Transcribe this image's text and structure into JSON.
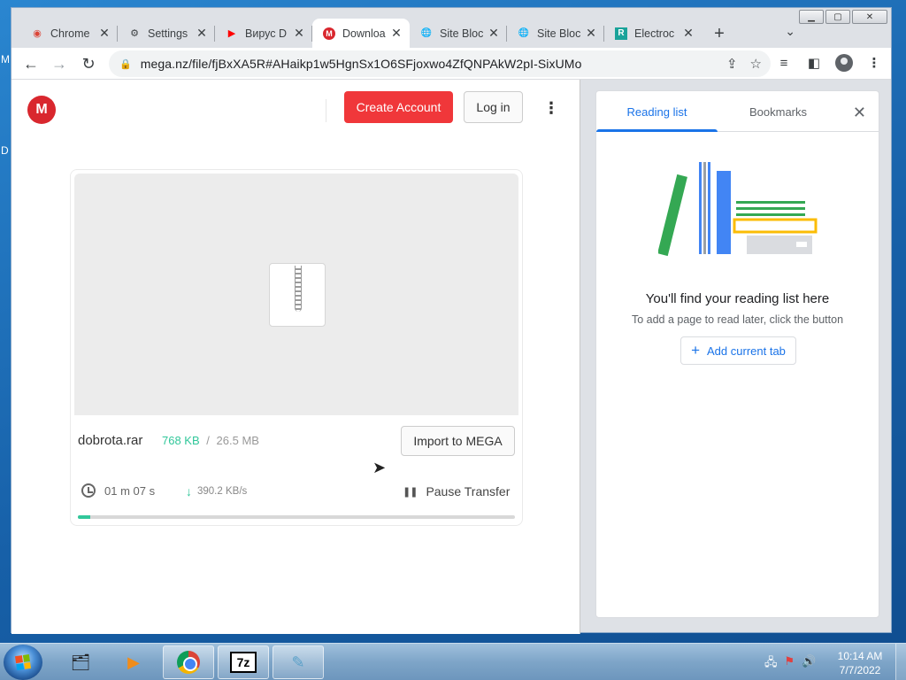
{
  "desktop": {
    "glyph_top": "M",
    "glyph_mid": "D"
  },
  "window_controls": {
    "minimize": "▁",
    "maximize": "▢",
    "close": "✕"
  },
  "tabs": [
    {
      "title": "Chrome",
      "icon": "chrome-icon",
      "icon_glyph": "◉",
      "icon_color": "#db4437",
      "close": "✕"
    },
    {
      "title": "Settings",
      "icon": "gear-icon",
      "icon_glyph": "⚙",
      "icon_color": "#3c4043",
      "close": "✕"
    },
    {
      "title": "Вирус D",
      "icon": "youtube-icon",
      "icon_glyph": "▶",
      "icon_color": "#ff0000",
      "close": "✕"
    },
    {
      "title": "Downloa",
      "icon": "mega-icon",
      "icon_glyph": "M",
      "icon_color": "#d9272e",
      "close": "✕",
      "active": true
    },
    {
      "title": "Site Bloc",
      "icon": "globe-icon",
      "icon_glyph": "🌐",
      "icon_color": "#3c4043",
      "close": "✕"
    },
    {
      "title": "Site Bloc",
      "icon": "globe-icon",
      "icon_glyph": "🌐",
      "icon_color": "#3c4043",
      "close": "✕"
    },
    {
      "title": "Electroc",
      "icon": "electrochem-icon",
      "icon_glyph": "R",
      "icon_color": "#1aa39a",
      "close": "✕"
    }
  ],
  "new_tab": "+",
  "tab_search": "⌄",
  "nav": {
    "back": "←",
    "forward": "→",
    "reload": "↻"
  },
  "address_bar": {
    "lock": "🔒",
    "url": "mega.nz/file/fjBxXA5R#AHaikp1w5HgnSx1O6SFjoxwo4ZfQNPAkW2pI-SixUMo",
    "share": "⇪",
    "star": "☆"
  },
  "toolbar_icons": {
    "reading_list": "≡",
    "side_panel": "◧",
    "menu": "⋮"
  },
  "mega": {
    "logo": "M",
    "create_account": "Create Account",
    "login": "Log in",
    "menu": "⋮",
    "file": {
      "name": "dobrota.rar",
      "downloaded": "768 KB",
      "separator": "/",
      "total": "26.5 MB",
      "import": "Import to MEGA",
      "time_remaining": "01 m  07 s",
      "speed": "390.2 KB/s",
      "speed_arrow": "↓",
      "pause_icon": "❚❚",
      "pause": "Pause Transfer",
      "progress_percent": 2.9
    },
    "progress_color": "#31c79a"
  },
  "reading_panel": {
    "tab_reading": "Reading list",
    "tab_bookmarks": "Bookmarks",
    "close": "✕",
    "title": "You'll find your reading list here",
    "subtitle": "To add a page to read later, click the button",
    "add_plus": "+",
    "add_label": "Add current tab",
    "accent": "#1a73e8"
  },
  "taskbar": {
    "apps": [
      {
        "name": "file-explorer-icon",
        "glyph": "🗂"
      },
      {
        "name": "media-player-icon",
        "glyph": "▶"
      },
      {
        "name": "chrome-taskbar-icon",
        "glyph": ""
      },
      {
        "name": "7zip-icon",
        "glyph": "7z"
      },
      {
        "name": "notepad-icon",
        "glyph": "✎"
      }
    ],
    "tray": {
      "network": "🖧",
      "flag": "⚑",
      "volume": "🔊"
    },
    "time": "10:14 AM",
    "date": "7/7/2022"
  }
}
